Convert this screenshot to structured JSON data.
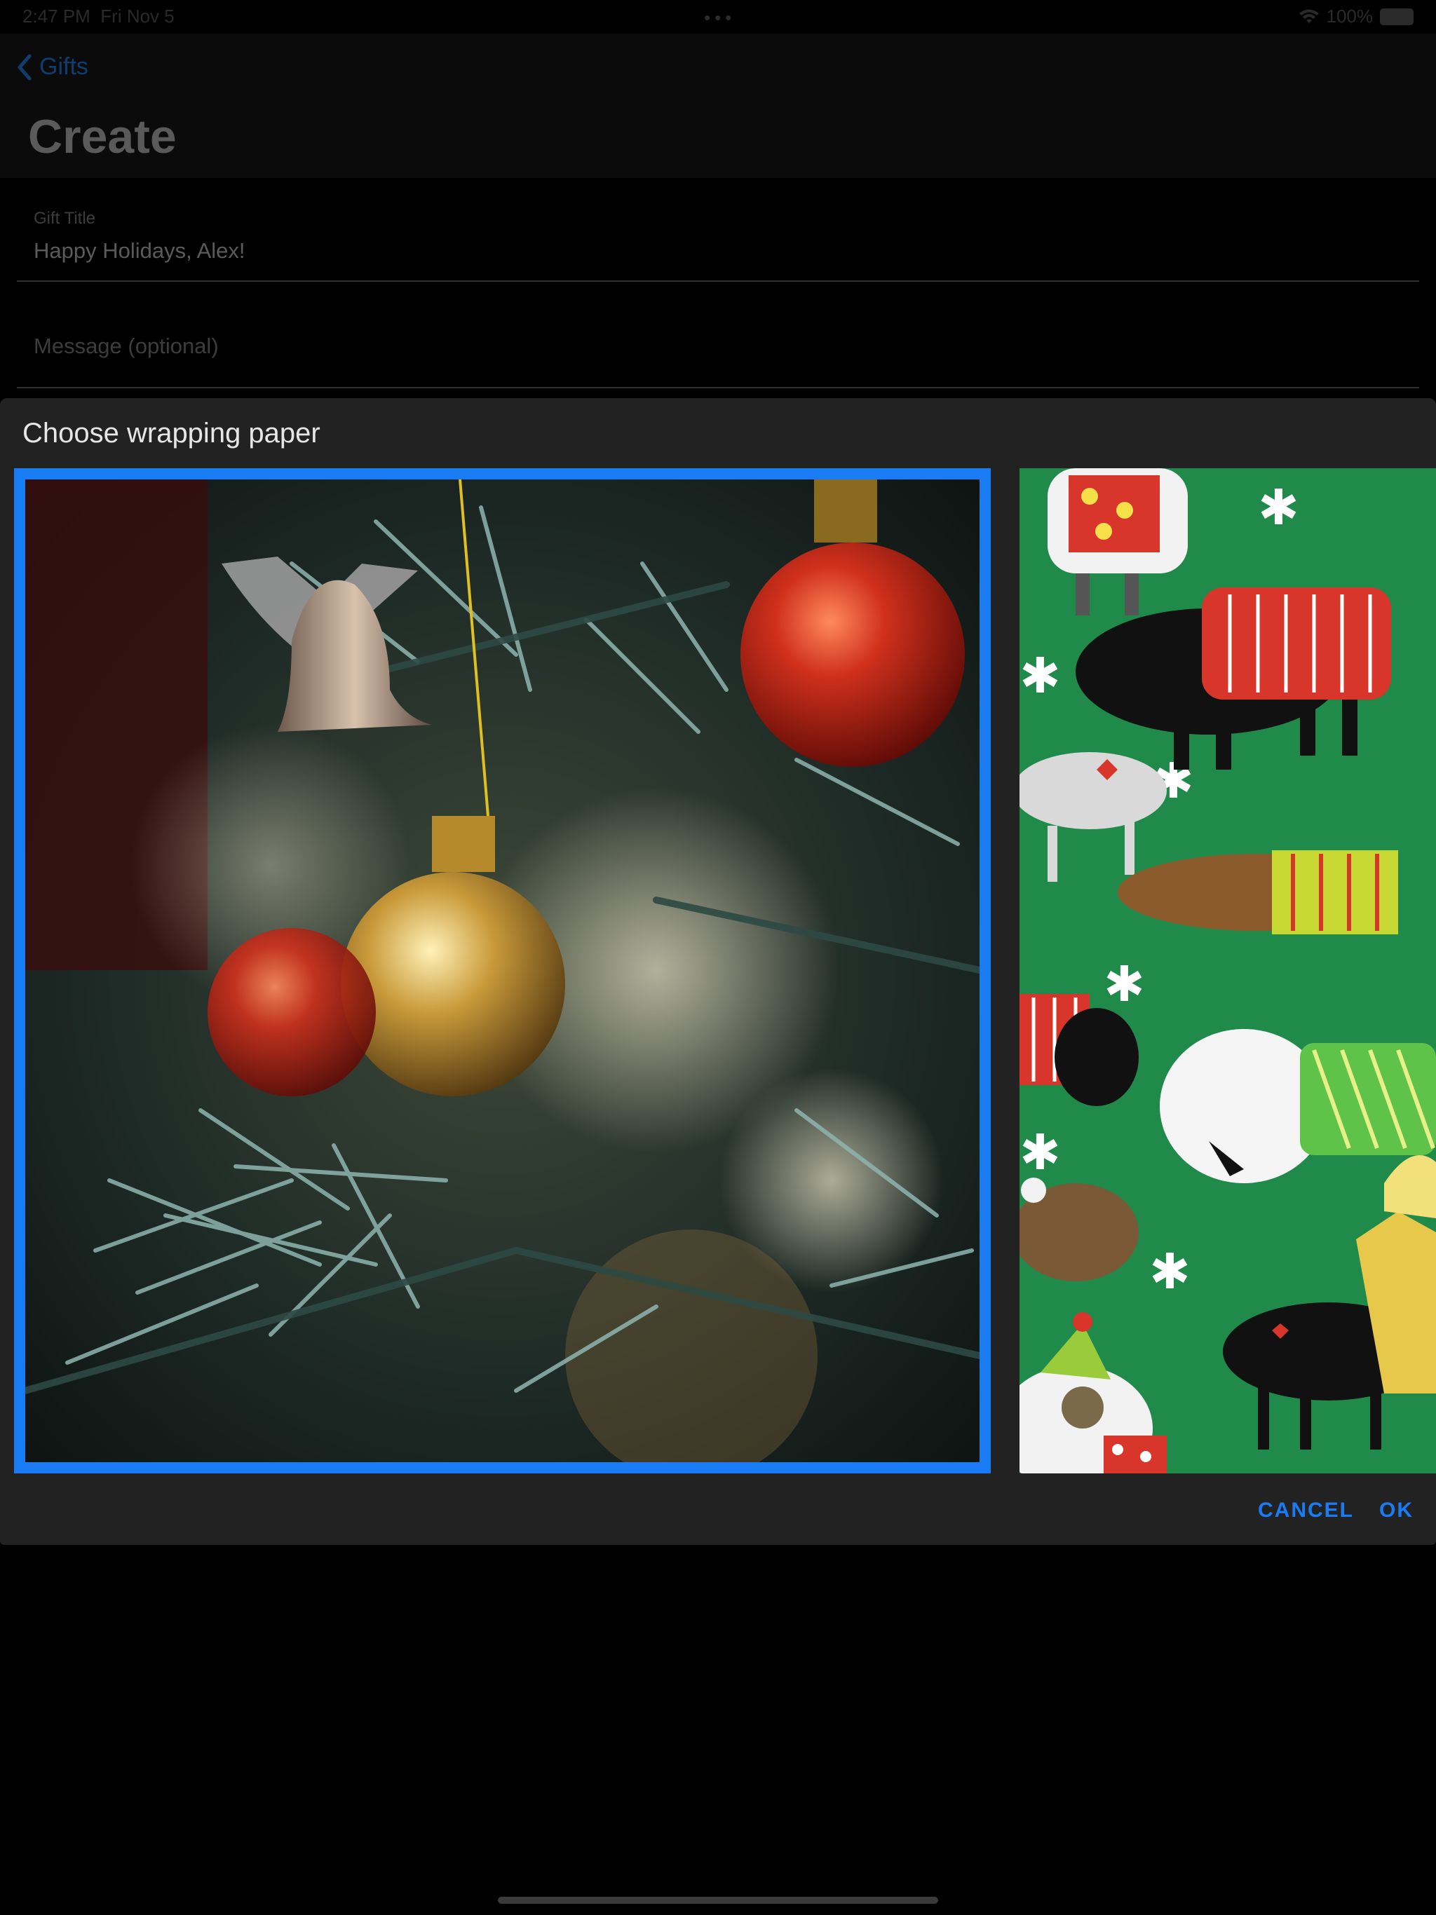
{
  "status_bar": {
    "time": "2:47 PM",
    "date": "Fri Nov 5",
    "battery": "100%",
    "dots": "•••"
  },
  "nav": {
    "back_label": "Gifts",
    "title": "Create"
  },
  "form": {
    "gift_title_caption": "Gift Title",
    "gift_title_value": "Happy Holidays, Alex!",
    "message_placeholder": "Message (optional)"
  },
  "dialog": {
    "title": "Choose wrapping paper",
    "options": [
      {
        "name": "christmas-ornaments",
        "selected": true
      },
      {
        "name": "dogs-in-sweaters",
        "selected": false
      }
    ],
    "cancel_label": "CANCEL",
    "ok_label": "OK"
  },
  "colors": {
    "accent": "#1a7cf5",
    "dialog_background": "#222222",
    "page_background": "#000000"
  }
}
